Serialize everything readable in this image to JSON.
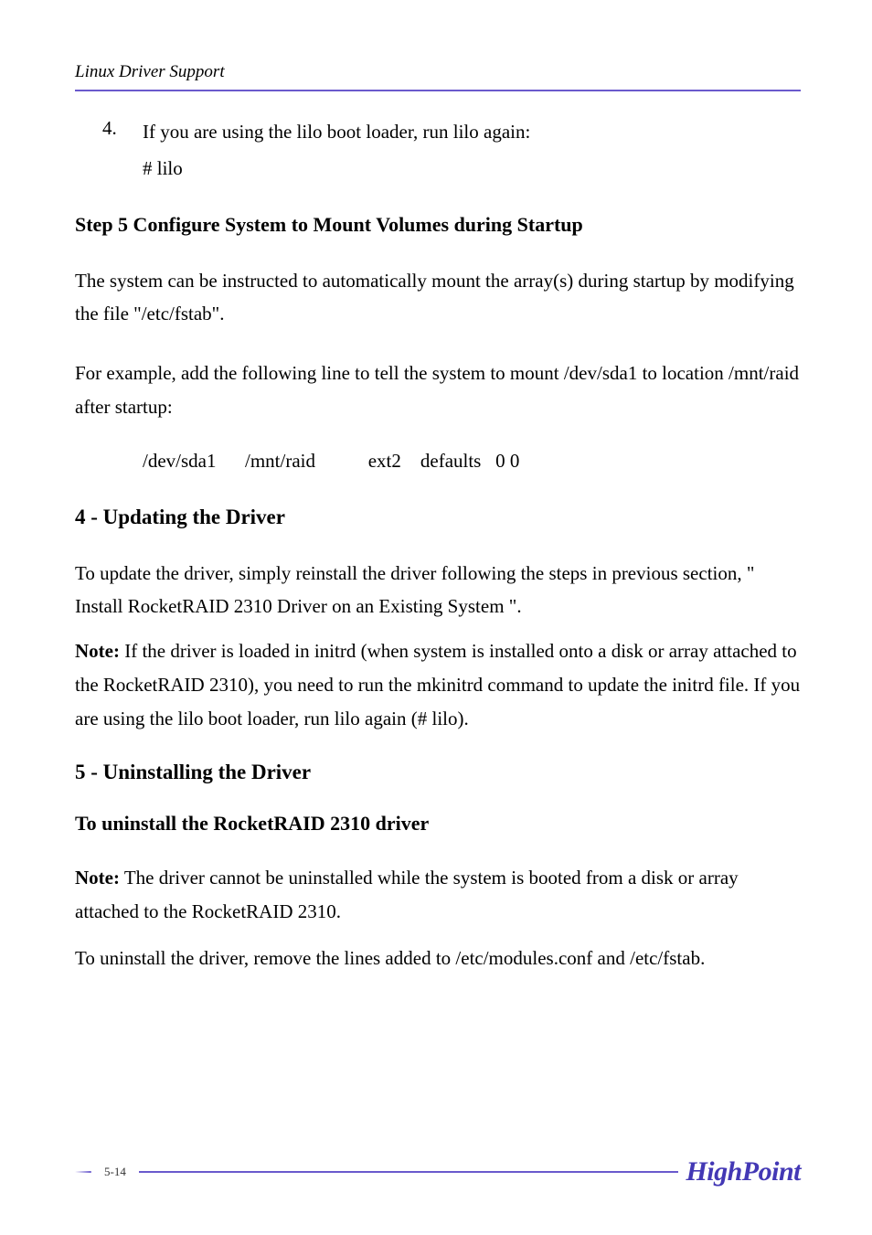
{
  "header": {
    "running_title": "Linux Driver Support"
  },
  "list_item_4": {
    "number": "4.",
    "text": "If you are using the lilo boot loader, run lilo again:",
    "code": "# lilo"
  },
  "step5": {
    "heading": "Step 5 Configure System to Mount Volumes during Startup",
    "para1": "The system can be instructed to automatically mount the array(s) during startup by modifying the file \"/etc/fstab\".",
    "para2": "For example, add the following line to tell the system to mount /dev/sda1 to location /mnt/raid after startup:",
    "fstab_line": "/dev/sda1      /mnt/raid           ext2    defaults   0 0"
  },
  "section4": {
    "heading": "4 - Updating the Driver",
    "para1": "To update the driver, simply reinstall the driver following the steps in previous section, \" Install RocketRAID 2310 Driver on an Existing System \".",
    "note_label": "Note:",
    "note_text": " If the driver is loaded in initrd (when system is installed onto a disk or array attached to the RocketRAID 2310), you need to run the mkinitrd command to update the initrd file. If you are using the lilo boot loader, run lilo again (# lilo)."
  },
  "section5": {
    "heading": "5 - Uninstalling the Driver",
    "subheading": "To uninstall the RocketRAID 2310 driver",
    "note_label": "Note:",
    "note_text": " The driver cannot be uninstalled while the system is booted from a disk or array attached to the RocketRAID 2310.",
    "para2": "To uninstall the driver, remove the lines added to /etc/modules.conf and /etc/fstab."
  },
  "footer": {
    "page_number": "5-14",
    "logo": "HighPoint"
  }
}
